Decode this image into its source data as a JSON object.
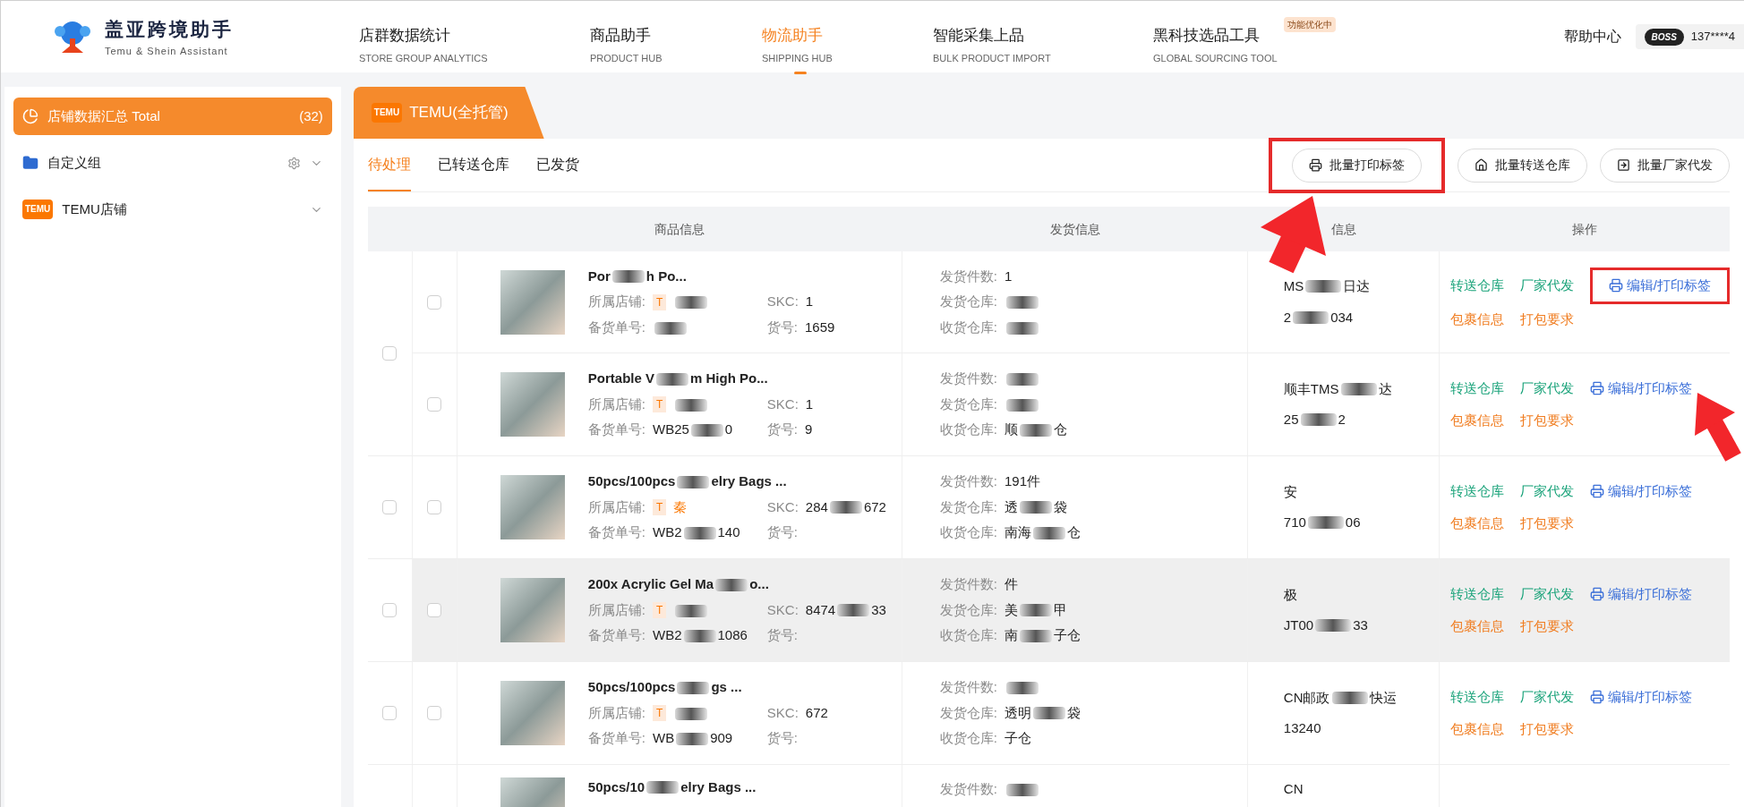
{
  "header": {
    "brand": "盖亚跨境助手",
    "brand_sub": "Temu & Shein Assistant",
    "nav": [
      {
        "label": "店群数据统计",
        "sub": "STORE GROUP ANALYTICS",
        "selected": false
      },
      {
        "label": "商品助手",
        "sub": "PRODUCT HUB",
        "selected": false
      },
      {
        "label": "物流助手",
        "sub": "SHIPPING HUB",
        "selected": true
      },
      {
        "label": "智能采集上品",
        "sub": "BULK PRODUCT IMPORT",
        "selected": false
      },
      {
        "label": "黑科技选品工具",
        "sub": "GLOBAL SOURCING TOOL",
        "selected": false,
        "badge": "功能优化中"
      }
    ],
    "help": "帮助中心",
    "boss": "BOSS",
    "account": "137****4"
  },
  "sidebar": {
    "items": [
      {
        "kind": "total",
        "label": "店铺数据汇总 Total",
        "count": "(32)",
        "selected": true
      },
      {
        "kind": "group",
        "label": "自定义组",
        "selected": false
      },
      {
        "kind": "store",
        "label": "TEMU店铺",
        "logo": "TEMU",
        "selected": false
      }
    ]
  },
  "main": {
    "tab": {
      "label": "TEMU(全托管)",
      "logo": "TEMU"
    },
    "subtabs": [
      {
        "label": "待处理",
        "selected": true
      },
      {
        "label": "已转送仓库",
        "selected": false
      },
      {
        "label": "已发货",
        "selected": false
      }
    ],
    "actions": [
      {
        "kind": "print",
        "label": "批量打印标签",
        "highlighted": true
      },
      {
        "kind": "warehouse",
        "label": "批量转送仓库",
        "highlighted": false
      },
      {
        "kind": "factory",
        "label": "批量厂家代发",
        "highlighted": false
      }
    ],
    "table": {
      "columns": [
        "商品信息",
        "发货信息",
        "信息",
        "操作"
      ],
      "groups": [
        {
          "checked": false,
          "rows": [
            {
              "checked": false,
              "hovered": false,
              "title": [
                "Por",
                "h Po..."
              ],
              "store": {
                "label": "所属店铺:",
                "badge": "T"
              },
              "skc": {
                "label": "SKC:",
                "value": [
                  "1"
                ]
              },
              "stock": {
                "label": "备货单号:"
              },
              "item": {
                "label": "货号:",
                "value": [
                  "1659"
                ]
              },
              "count": {
                "label": "发货件数:",
                "value": [
                  "1"
                ]
              },
              "from": {
                "label": "发货仓库:"
              },
              "to": {
                "label": "收货仓库:"
              },
              "log1": [
                "MS",
                "日达"
              ],
              "log2": [
                "2",
                "034"
              ],
              "ops": [
                {
                  "kind": "transfer",
                  "label": "转送仓库"
                },
                {
                  "kind": "factory",
                  "label": "厂家代发"
                },
                {
                  "kind": "print",
                  "label": "编辑/打印标签",
                  "highlighted": true
                },
                {
                  "kind": "parcel",
                  "label": "包裹信息"
                },
                {
                  "kind": "packing",
                  "label": "打包要求"
                }
              ]
            },
            {
              "checked": false,
              "hovered": false,
              "title": [
                "Portable V",
                "m High Po..."
              ],
              "store": {
                "label": "所属店铺:",
                "badge": "T"
              },
              "skc": {
                "label": "SKC:",
                "value": [
                  "1"
                ]
              },
              "stock": {
                "label": "备货单号:",
                "value": [
                  "WB25",
                  "0"
                ]
              },
              "item": {
                "label": "货号:",
                "value": [
                  "9"
                ]
              },
              "count": {
                "label": "发货件数:"
              },
              "from": {
                "label": "发货仓库:"
              },
              "to": {
                "label": "收货仓库:",
                "value": [
                  "顺",
                  "仓"
                ]
              },
              "log1": [
                "顺丰TMS",
                "达"
              ],
              "log2": [
                "25",
                "2"
              ],
              "ops": [
                {
                  "kind": "transfer",
                  "label": "转送仓库"
                },
                {
                  "kind": "factory",
                  "label": "厂家代发"
                },
                {
                  "kind": "print",
                  "label": "编辑/打印标签",
                  "highlighted": false
                },
                {
                  "kind": "parcel",
                  "label": "包裹信息"
                },
                {
                  "kind": "packing",
                  "label": "打包要求"
                }
              ]
            }
          ]
        },
        {
          "checked": false,
          "rows": [
            {
              "checked": false,
              "hovered": false,
              "title": [
                "50pcs/100pcs",
                "elry Bags ..."
              ],
              "store": {
                "label": "所属店铺:",
                "badge": "T",
                "value": [
                  "秦"
                ]
              },
              "skc": {
                "label": "SKC:",
                "value": [
                  "284",
                  "672"
                ]
              },
              "stock": {
                "label": "备货单号:",
                "value": [
                  "WB2",
                  "140"
                ]
              },
              "item": {
                "label": "货号:"
              },
              "count": {
                "label": "发货件数:",
                "value": [
                  "191件"
                ]
              },
              "from": {
                "label": "发货仓库:",
                "value": [
                  "透",
                  "袋"
                ]
              },
              "to": {
                "label": "收货仓库:",
                "value": [
                  "南海",
                  "仓"
                ]
              },
              "log1": [
                "安"
              ],
              "log2": [
                "710",
                "06"
              ],
              "ops": [
                {
                  "kind": "transfer",
                  "label": "转送仓库"
                },
                {
                  "kind": "factory",
                  "label": "厂家代发"
                },
                {
                  "kind": "print",
                  "label": "编辑/打印标签",
                  "highlighted": false
                },
                {
                  "kind": "parcel",
                  "label": "包裹信息"
                },
                {
                  "kind": "packing",
                  "label": "打包要求"
                }
              ]
            }
          ]
        },
        {
          "checked": false,
          "rows": [
            {
              "checked": false,
              "hovered": true,
              "title": [
                "200x Acrylic Gel Ma",
                "o..."
              ],
              "store": {
                "label": "所属店铺:",
                "badge": "T"
              },
              "skc": {
                "label": "SKC:",
                "value": [
                  "8474",
                  "33"
                ]
              },
              "stock": {
                "label": "备货单号:",
                "value": [
                  "WB2",
                  "1086"
                ]
              },
              "item": {
                "label": "货号:"
              },
              "count": {
                "label": "发货件数:",
                "value": [
                  "件"
                ]
              },
              "from": {
                "label": "发货仓库:",
                "value": [
                  "美",
                  "甲"
                ]
              },
              "to": {
                "label": "收货仓库:",
                "value": [
                  "南",
                  "子仓"
                ]
              },
              "log1": [
                "极"
              ],
              "log2": [
                "JT00",
                "33"
              ],
              "ops": [
                {
                  "kind": "transfer",
                  "label": "转送仓库"
                },
                {
                  "kind": "factory",
                  "label": "厂家代发"
                },
                {
                  "kind": "print",
                  "label": "编辑/打印标签",
                  "highlighted": false
                },
                {
                  "kind": "parcel",
                  "label": "包裹信息"
                },
                {
                  "kind": "packing",
                  "label": "打包要求"
                }
              ]
            }
          ]
        },
        {
          "checked": false,
          "rows": [
            {
              "checked": false,
              "hovered": false,
              "title": [
                "50pcs/100pcs",
                "gs ..."
              ],
              "store": {
                "label": "所属店铺:",
                "badge": "T"
              },
              "skc": {
                "label": "SKC:",
                "value": [
                  "672"
                ]
              },
              "stock": {
                "label": "备货单号:",
                "value": [
                  "WB",
                  "909"
                ]
              },
              "item": {
                "label": "货号:"
              },
              "count": {
                "label": "发货件数:"
              },
              "from": {
                "label": "发货仓库:",
                "value": [
                  "透明",
                  "袋"
                ]
              },
              "to": {
                "label": "收货仓库:",
                "value": [
                  "子仓"
                ]
              },
              "log1": [
                "CN邮政",
                "快运"
              ],
              "log2": [
                "13240"
              ],
              "ops": [
                {
                  "kind": "transfer",
                  "label": "转送仓库"
                },
                {
                  "kind": "factory",
                  "label": "厂家代发"
                },
                {
                  "kind": "print",
                  "label": "编辑/打印标签",
                  "highlighted": false
                },
                {
                  "kind": "parcel",
                  "label": "包裹信息"
                },
                {
                  "kind": "packing",
                  "label": "打包要求"
                }
              ]
            }
          ]
        },
        {
          "rows": [
            {
              "partial": true,
              "title": [
                "50pcs/10",
                "elry Bags ..."
              ],
              "count": {
                "label": "发货件数:"
              },
              "log1": [
                "CN"
              ]
            }
          ]
        }
      ]
    }
  }
}
